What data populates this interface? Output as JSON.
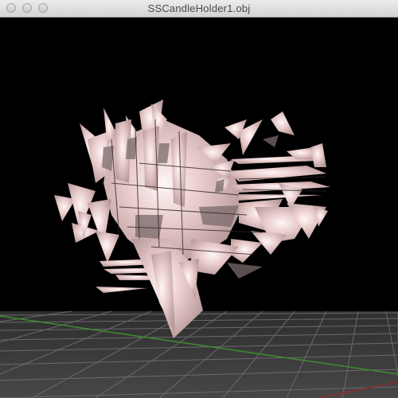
{
  "window": {
    "title": "SSCandleHolder1.obj",
    "controls": {
      "close": "close-button",
      "minimize": "minimize-button",
      "zoom": "zoom-button"
    }
  },
  "viewport": {
    "background": "#000000",
    "model_color": "#f0d6d6",
    "floor_color": "#3a3a3a",
    "grid_color": "#5a5a5a",
    "axis_green": "#3f8a2e",
    "axis_red": "#8a2e2e"
  }
}
